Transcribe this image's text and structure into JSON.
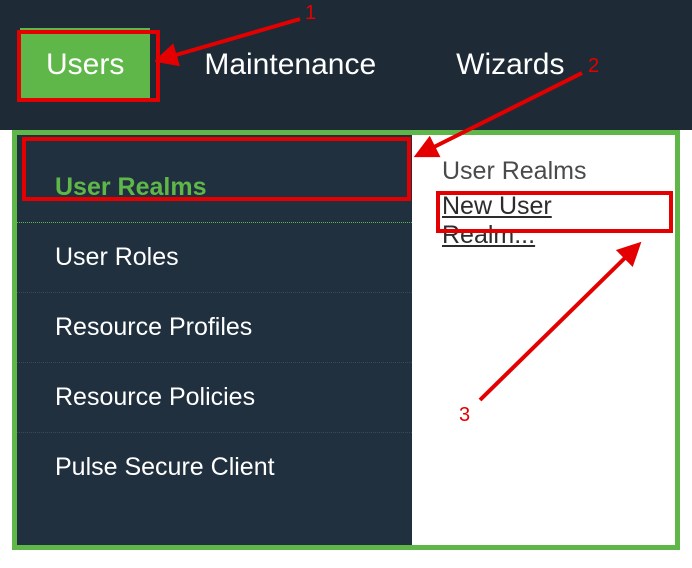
{
  "topbar": {
    "tabs": [
      {
        "label": "Users",
        "active": true
      },
      {
        "label": "Maintenance",
        "active": false
      },
      {
        "label": "Wizards",
        "active": false
      }
    ]
  },
  "sidebar": {
    "items": [
      {
        "label": "User Realms",
        "active": true
      },
      {
        "label": "User Roles",
        "active": false
      },
      {
        "label": "Resource Profiles",
        "active": false
      },
      {
        "label": "Resource Policies",
        "active": false
      },
      {
        "label": "Pulse Secure Client",
        "active": false
      }
    ]
  },
  "main": {
    "heading": "User Realms",
    "new_link": "New User Realm..."
  },
  "annotations": {
    "label1": "1",
    "label2": "2",
    "label3": "3"
  }
}
